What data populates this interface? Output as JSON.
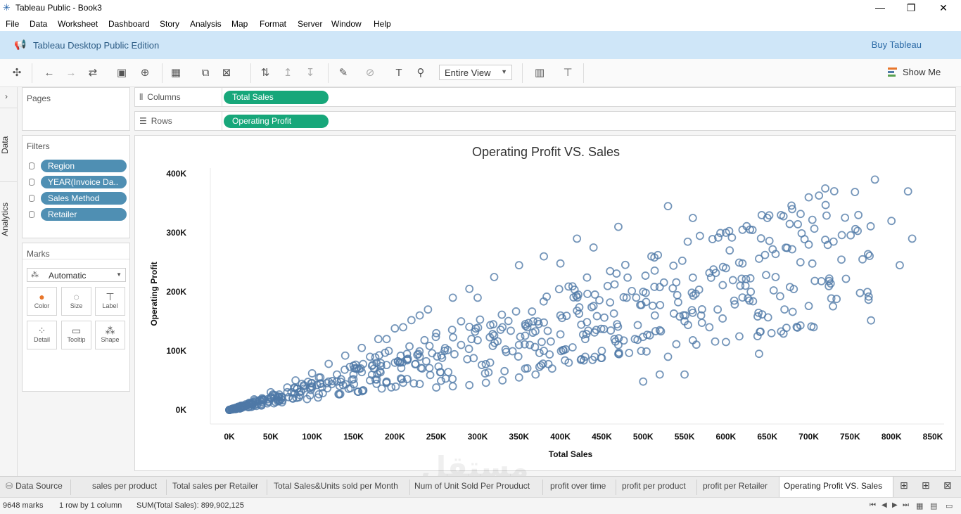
{
  "window": {
    "title": "Tableau Public - Book3",
    "minimize": "—",
    "maximize": "❐",
    "close": "✕"
  },
  "menu": [
    "File",
    "Data",
    "Worksheet",
    "Dashboard",
    "Story",
    "Analysis",
    "Map",
    "Format",
    "Server",
    "Window",
    "Help"
  ],
  "banner": {
    "text": "Tableau Desktop Public Edition",
    "buy": "Buy Tableau"
  },
  "toolbar": {
    "fit": "Entire View",
    "show_me": "Show Me"
  },
  "side_tabs": {
    "data": "Data",
    "analytics": "Analytics"
  },
  "pages": {
    "title": "Pages"
  },
  "filters": {
    "title": "Filters",
    "items": [
      "Region",
      "YEAR(Invoice Da..",
      "Sales Method",
      "Retailer"
    ]
  },
  "marks": {
    "title": "Marks",
    "type": "Automatic",
    "buttons": [
      {
        "label": "Color",
        "icon": "color-icon"
      },
      {
        "label": "Size",
        "icon": "size-icon"
      },
      {
        "label": "Label",
        "icon": "label-icon"
      },
      {
        "label": "Detail",
        "icon": "detail-icon"
      },
      {
        "label": "Tooltip",
        "icon": "tooltip-icon"
      },
      {
        "label": "Shape",
        "icon": "shape-icon"
      }
    ]
  },
  "shelves": {
    "columns": {
      "label": "Columns",
      "pill": "Total Sales"
    },
    "rows": {
      "label": "Rows",
      "pill": "Operating Profit"
    }
  },
  "chart_data": {
    "type": "scatter",
    "title": "Operating Profit VS. Sales",
    "xlabel": "Total Sales",
    "ylabel": "Operating Profit",
    "xlim": [
      0,
      850000
    ],
    "ylim": [
      0,
      400000
    ],
    "x_ticks": [
      "0K",
      "50K",
      "100K",
      "150K",
      "200K",
      "250K",
      "300K",
      "350K",
      "400K",
      "450K",
      "500K",
      "550K",
      "600K",
      "650K",
      "700K",
      "750K",
      "800K",
      "850K"
    ],
    "y_ticks": [
      "0K",
      "100K",
      "200K",
      "300K",
      "400K"
    ],
    "grid": false,
    "marker": "hollow-circle",
    "color": "#4e79a7",
    "margin_bands": [
      0.2,
      0.25,
      0.3,
      0.35,
      0.4,
      0.45,
      0.5
    ],
    "points": [
      [
        20000,
        8000
      ],
      [
        35000,
        14000
      ],
      [
        50000,
        20000
      ],
      [
        60000,
        22000
      ],
      [
        75000,
        30000
      ],
      [
        90000,
        36000
      ],
      [
        100000,
        38000
      ],
      [
        110000,
        45000
      ],
      [
        120000,
        48000
      ],
      [
        135000,
        52000
      ],
      [
        150000,
        60000
      ],
      [
        160000,
        64000
      ],
      [
        175000,
        70000
      ],
      [
        190000,
        76000
      ],
      [
        200000,
        80000
      ],
      [
        215000,
        84000
      ],
      [
        230000,
        90000
      ],
      [
        245000,
        96000
      ],
      [
        260000,
        100000
      ],
      [
        280000,
        110000
      ],
      [
        300000,
        118000
      ],
      [
        320000,
        126000
      ],
      [
        340000,
        134000
      ],
      [
        360000,
        140000
      ],
      [
        380000,
        148000
      ],
      [
        400000,
        160000
      ],
      [
        420000,
        168000
      ],
      [
        440000,
        176000
      ],
      [
        460000,
        182000
      ],
      [
        480000,
        190000
      ],
      [
        500000,
        200000
      ],
      [
        520000,
        208000
      ],
      [
        540000,
        216000
      ],
      [
        560000,
        224000
      ],
      [
        580000,
        232000
      ],
      [
        600000,
        240000
      ],
      [
        620000,
        248000
      ],
      [
        640000,
        256000
      ],
      [
        660000,
        264000
      ],
      [
        680000,
        272000
      ],
      [
        700000,
        280000
      ],
      [
        720000,
        288000
      ],
      [
        740000,
        296000
      ],
      [
        760000,
        330000
      ],
      [
        780000,
        390000
      ],
      [
        800000,
        320000
      ],
      [
        820000,
        370000
      ],
      [
        825000,
        290000
      ],
      [
        810000,
        245000
      ],
      [
        765000,
        255000
      ],
      [
        745000,
        222000
      ],
      [
        700000,
        176000
      ],
      [
        690000,
        143000
      ],
      [
        655000,
        130000
      ],
      [
        640000,
        95000
      ],
      [
        600000,
        115000
      ],
      [
        580000,
        140000
      ],
      [
        560000,
        118000
      ],
      [
        550000,
        60000
      ],
      [
        530000,
        90000
      ],
      [
        520000,
        60000
      ],
      [
        500000,
        48000
      ],
      [
        470000,
        95000
      ],
      [
        450000,
        88000
      ],
      [
        430000,
        120000
      ],
      [
        400000,
        128000
      ],
      [
        380000,
        100000
      ],
      [
        350000,
        110000
      ],
      [
        330000,
        140000
      ],
      [
        300000,
        190000
      ],
      [
        280000,
        150000
      ],
      [
        250000,
        130000
      ],
      [
        230000,
        160000
      ],
      [
        210000,
        140000
      ],
      [
        190000,
        120000
      ],
      [
        170000,
        90000
      ],
      [
        150000,
        75000
      ],
      [
        130000,
        60000
      ],
      [
        110000,
        55000
      ],
      [
        90000,
        40000
      ],
      [
        70000,
        30000
      ],
      [
        55000,
        25000
      ],
      [
        40000,
        16000
      ],
      [
        25000,
        10000
      ],
      [
        380000,
        260000
      ],
      [
        350000,
        245000
      ],
      [
        320000,
        225000
      ],
      [
        290000,
        205000
      ],
      [
        270000,
        190000
      ],
      [
        240000,
        170000
      ],
      [
        220000,
        152000
      ],
      [
        200000,
        138000
      ],
      [
        180000,
        120000
      ],
      [
        160000,
        105000
      ],
      [
        140000,
        92000
      ],
      [
        120000,
        78000
      ],
      [
        100000,
        62000
      ],
      [
        80000,
        50000
      ],
      [
        470000,
        310000
      ],
      [
        440000,
        275000
      ],
      [
        420000,
        290000
      ],
      [
        400000,
        248000
      ],
      [
        460000,
        235000
      ],
      [
        510000,
        260000
      ],
      [
        530000,
        345000
      ],
      [
        560000,
        325000
      ],
      [
        600000,
        300000
      ],
      [
        620000,
        305000
      ],
      [
        650000,
        325000
      ],
      [
        680000,
        340000
      ],
      [
        720000,
        375000
      ],
      [
        700000,
        360000
      ],
      [
        730000,
        285000
      ],
      [
        690000,
        250000
      ],
      [
        660000,
        225000
      ],
      [
        630000,
        200000
      ],
      [
        610000,
        185000
      ],
      [
        590000,
        170000
      ],
      [
        570000,
        160000
      ],
      [
        550000,
        150000
      ],
      [
        520000,
        135000
      ],
      [
        490000,
        120000
      ],
      [
        470000,
        110000
      ],
      [
        450000,
        100000
      ],
      [
        430000,
        90000
      ],
      [
        410000,
        80000
      ],
      [
        390000,
        70000
      ],
      [
        370000,
        60000
      ],
      [
        350000,
        55000
      ],
      [
        330000,
        50000
      ],
      [
        310000,
        46000
      ],
      [
        290000,
        42000
      ],
      [
        270000,
        40000
      ],
      [
        250000,
        38000
      ],
      [
        230000,
        44000
      ],
      [
        210000,
        46000
      ],
      [
        190000,
        48000
      ],
      [
        170000,
        50000
      ],
      [
        150000,
        52000
      ],
      [
        130000,
        48000
      ],
      [
        110000,
        44000
      ],
      [
        90000,
        42000
      ],
      [
        70000,
        38000
      ],
      [
        50000,
        30000
      ],
      [
        30000,
        18000
      ],
      [
        10000,
        4000
      ],
      [
        5000,
        2000
      ]
    ]
  },
  "sheet_tabs": {
    "data_source": "Data Source",
    "tabs": [
      "sales per product",
      "Total sales per Retailer",
      "Total Sales&Units sold per Month",
      "Num of Unit  Sold Per Prouduct",
      "profit over time",
      "profit per product",
      "profit per Retailer",
      "Operating Profit VS. Sales"
    ],
    "active": "Operating Profit VS. Sales"
  },
  "status": {
    "marks": "9648 marks",
    "dims": "1 row by 1 column",
    "sum": "SUM(Total Sales): 899,902,125"
  },
  "watermark": "مستقل"
}
